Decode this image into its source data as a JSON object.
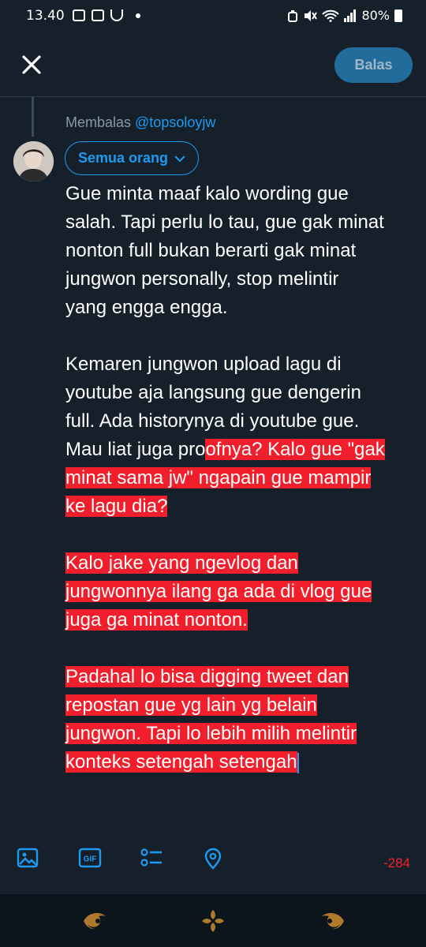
{
  "status_bar": {
    "time": "13.40",
    "battery": "80%"
  },
  "header": {
    "close_icon": "close-icon",
    "reply_label": "Balas"
  },
  "compose": {
    "replying_prefix": "Membalas ",
    "replying_handle": "@topsoloyjw",
    "audience_label": "Semua orang",
    "lines": [
      {
        "plain": "Gue minta maaf kalo wording gue",
        "hl": ""
      },
      {
        "plain": "salah. Tapi perlu lo tau, gue gak minat",
        "hl": ""
      },
      {
        "plain": "nonton full bukan berarti gak minat",
        "hl": ""
      },
      {
        "plain": "jungwon personally, stop melintir",
        "hl": ""
      },
      {
        "plain": "yang engga engga.",
        "hl": ""
      },
      {
        "plain": "Kemaren jungwon upload lagu di",
        "hl": ""
      },
      {
        "plain": "youtube aja langsung gue dengerin",
        "hl": ""
      },
      {
        "plain": "full. Ada historynya di youtube gue.",
        "hl": ""
      },
      {
        "plain": "Mau liat juga pro",
        "hl": "ofnya? Kalo gue \"gak"
      },
      {
        "plain": "",
        "hl": "minat sama jw\" ngapain gue mampir"
      },
      {
        "plain": "",
        "hl": "ke lagu dia?"
      },
      {
        "plain": "",
        "hl": "Kalo jake yang ngevlog dan"
      },
      {
        "plain": "",
        "hl": "jungwonnya ilang ga ada di vlog gue"
      },
      {
        "plain": "",
        "hl": "juga ga minat nonton."
      },
      {
        "plain": "",
        "hl": "Padahal lo bisa digging tweet dan"
      },
      {
        "plain": "",
        "hl": "repostan gue yg lain yg belain"
      },
      {
        "plain": "",
        "hl": "jungwon. Tapi lo lebih milih melintir"
      },
      {
        "plain": "",
        "hl": "konteks setengah setengah"
      }
    ],
    "char_count": "-284"
  },
  "colors": {
    "background": "#15202b",
    "accent": "#1d9bf0",
    "highlight": "#f11e2b",
    "error": "#f4212e"
  }
}
